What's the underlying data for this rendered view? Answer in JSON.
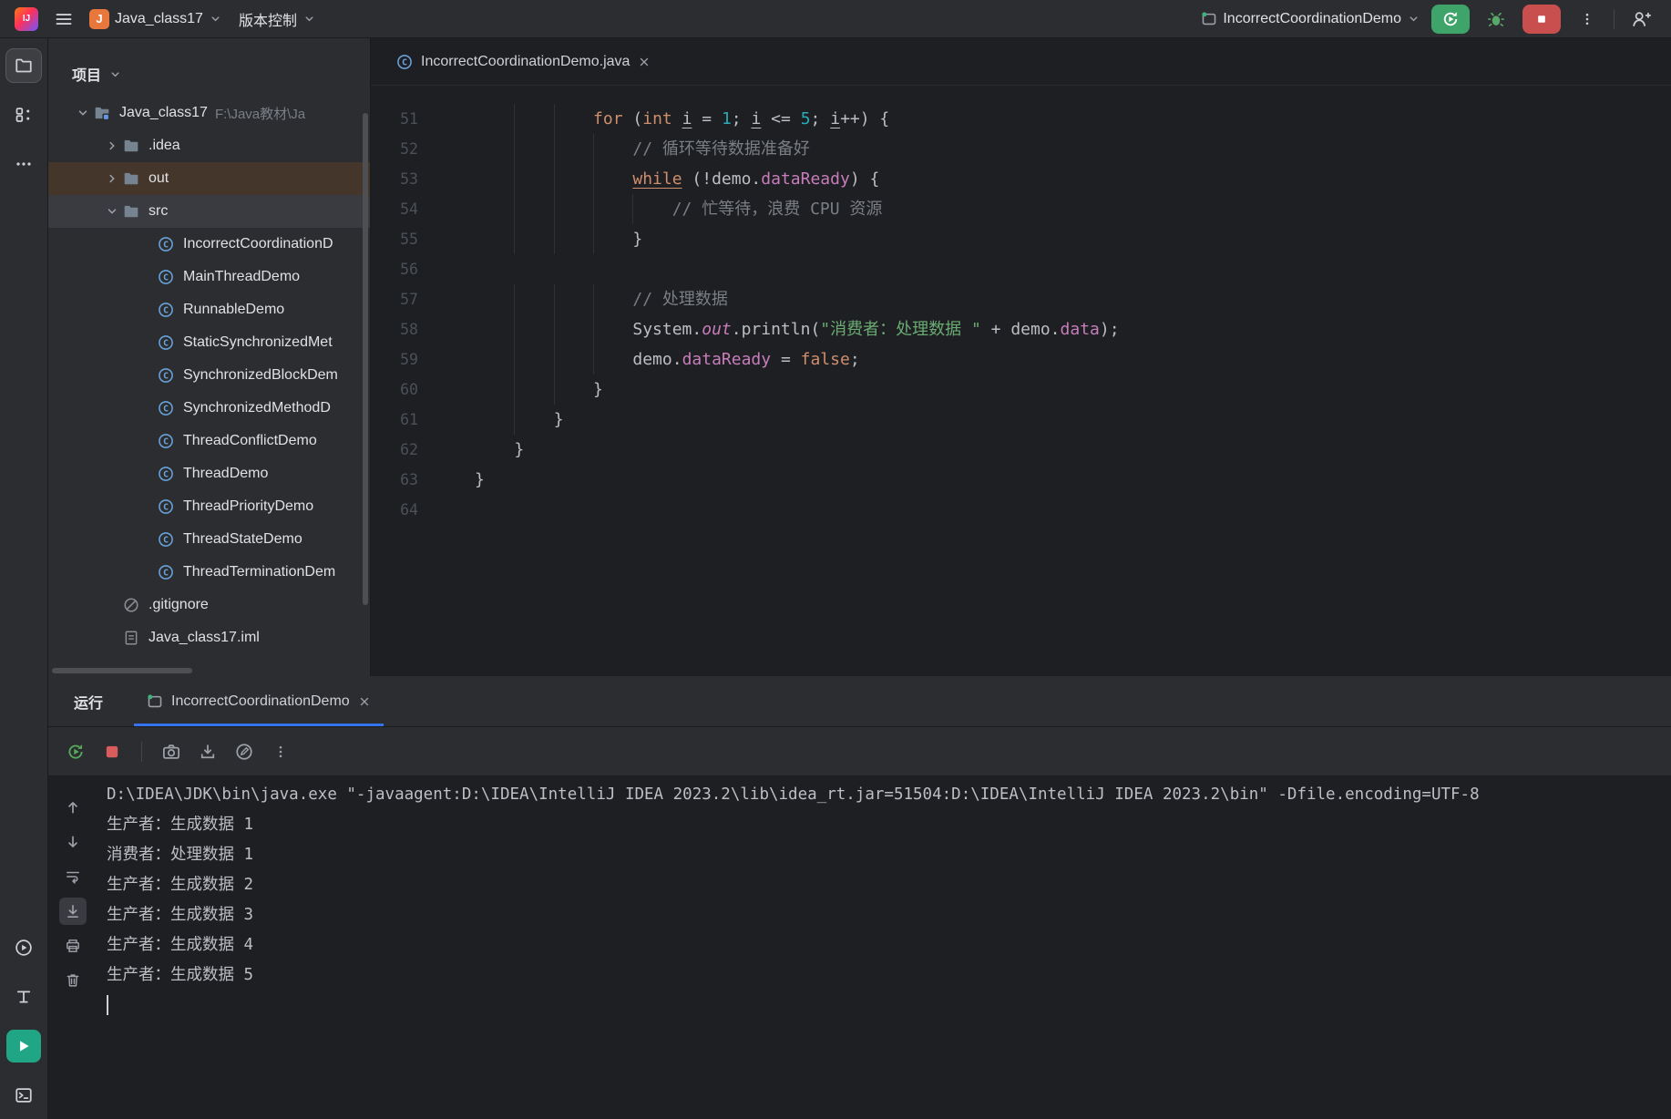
{
  "colors": {
    "accent": "#3574f0",
    "run_green": "#3fa469",
    "stop_red": "#c94f4f",
    "tool_teal": "#21a685",
    "tab_underline": "#3574f0"
  },
  "titlebar": {
    "logo_text": "IJ",
    "project_badge_letter": "J",
    "project_name": "Java_class17",
    "vcs_label": "版本控制",
    "run_config_name": "IncorrectCoordinationDemo",
    "icons": [
      "menu-icon",
      "chevron-down-icon",
      "run-config-window-icon",
      "rerun-icon",
      "debug-icon",
      "stop-icon",
      "more-vertical-icon",
      "add-user-icon"
    ]
  },
  "toolstrip": {
    "top": [
      {
        "icon": "project-folder",
        "selected": true
      },
      {
        "icon": "structure",
        "selected": false
      },
      {
        "icon": "more",
        "selected": false
      }
    ],
    "bottom": [
      {
        "icon": "services",
        "selected": false
      },
      {
        "icon": "hierarchy",
        "selected": false
      },
      {
        "icon": "run-tool",
        "selected": true,
        "accent": true
      },
      {
        "icon": "terminal",
        "selected": false
      }
    ]
  },
  "project_panel": {
    "title": "项目",
    "items": [
      {
        "level": 0,
        "chevron": "down",
        "icon": "folder-root",
        "name": "Java_class17",
        "path": "F:\\Java教材\\Ja"
      },
      {
        "level": 1,
        "chevron": "right",
        "icon": "folder",
        "name": ".idea"
      },
      {
        "level": 1,
        "chevron": "right",
        "icon": "folder",
        "name": "out",
        "state": "highlighted"
      },
      {
        "level": 1,
        "chevron": "down",
        "icon": "folder",
        "name": "src",
        "state": "selected"
      },
      {
        "level": 2,
        "icon": "class",
        "name": "IncorrectCoordinationD"
      },
      {
        "level": 2,
        "icon": "class",
        "name": "MainThreadDemo"
      },
      {
        "level": 2,
        "icon": "class",
        "name": "RunnableDemo"
      },
      {
        "level": 2,
        "icon": "class",
        "name": "StaticSynchronizedMet"
      },
      {
        "level": 2,
        "icon": "class",
        "name": "SynchronizedBlockDem"
      },
      {
        "level": 2,
        "icon": "class",
        "name": "SynchronizedMethodD"
      },
      {
        "level": 2,
        "icon": "class",
        "name": "ThreadConflictDemo"
      },
      {
        "level": 2,
        "icon": "class",
        "name": "ThreadDemo"
      },
      {
        "level": 2,
        "icon": "class",
        "name": "ThreadPriorityDemo"
      },
      {
        "level": 2,
        "icon": "class",
        "name": "ThreadStateDemo"
      },
      {
        "level": 2,
        "icon": "class",
        "name": "ThreadTerminationDem"
      },
      {
        "level": 1,
        "icon": "ignore",
        "name": ".gitignore"
      },
      {
        "level": 1,
        "icon": "iml",
        "name": "Java_class17.iml"
      }
    ]
  },
  "editor": {
    "tab_label": "IncorrectCoordinationDemo.java",
    "lines": [
      {
        "n": 51,
        "ind": 12,
        "tok": [
          [
            "kw",
            "for"
          ],
          [
            "pln",
            " ("
          ],
          [
            "kw",
            "int"
          ],
          [
            "pln",
            " "
          ],
          [
            "var",
            "i"
          ],
          [
            "pln",
            " = "
          ],
          [
            "num",
            "1"
          ],
          [
            "pln",
            "; "
          ],
          [
            "var",
            "i"
          ],
          [
            "pln",
            " <= "
          ],
          [
            "num",
            "5"
          ],
          [
            "pln",
            "; "
          ],
          [
            "var",
            "i"
          ],
          [
            "pln",
            "++) {"
          ]
        ]
      },
      {
        "n": 52,
        "ind": 16,
        "tok": [
          [
            "cmt",
            "// 循环等待数据准备好"
          ]
        ]
      },
      {
        "n": 53,
        "ind": 16,
        "tok": [
          [
            "kwund",
            "while"
          ],
          [
            "pln",
            " (!demo."
          ],
          [
            "fld",
            "dataReady"
          ],
          [
            "pln",
            ") {"
          ]
        ]
      },
      {
        "n": 54,
        "ind": 20,
        "tok": [
          [
            "cmt",
            "// 忙等待，浪费 CPU 资源"
          ]
        ]
      },
      {
        "n": 55,
        "ind": 16,
        "tok": [
          [
            "pln",
            "}"
          ]
        ]
      },
      {
        "n": 56,
        "ind": 0,
        "tok": []
      },
      {
        "n": 57,
        "ind": 16,
        "tok": [
          [
            "cmt",
            "// 处理数据"
          ]
        ]
      },
      {
        "n": 58,
        "ind": 16,
        "tok": [
          [
            "pln",
            "System."
          ],
          [
            "fldit",
            "out"
          ],
          [
            "pln",
            ".println("
          ],
          [
            "str",
            "\"消费者：处理数据 \""
          ],
          [
            "pln",
            " + demo."
          ],
          [
            "fld",
            "data"
          ],
          [
            "pln",
            ");"
          ]
        ]
      },
      {
        "n": 59,
        "ind": 16,
        "tok": [
          [
            "pln",
            "demo."
          ],
          [
            "fld",
            "dataReady"
          ],
          [
            "pln",
            " = "
          ],
          [
            "kw",
            "false"
          ],
          [
            "pln",
            ";"
          ]
        ]
      },
      {
        "n": 60,
        "ind": 12,
        "tok": [
          [
            "pln",
            "}"
          ]
        ]
      },
      {
        "n": 61,
        "ind": 8,
        "tok": [
          [
            "pln",
            "}"
          ]
        ]
      },
      {
        "n": 62,
        "ind": 4,
        "tok": [
          [
            "pln",
            "}"
          ]
        ]
      },
      {
        "n": 63,
        "ind": 0,
        "tok": [
          [
            "pln",
            "}"
          ]
        ]
      },
      {
        "n": 64,
        "ind": 0,
        "tok": []
      }
    ]
  },
  "run_panel": {
    "title": "运行",
    "tab_label": "IncorrectCoordinationDemo",
    "toolbar": [
      "rerun",
      "stop",
      "separator",
      "camera",
      "export",
      "edit",
      "more-v"
    ],
    "console": {
      "gutter": [
        {
          "icon": "up"
        },
        {
          "icon": "down"
        },
        {
          "icon": "softwrap"
        },
        {
          "icon": "scrollend",
          "selected": true
        },
        {
          "icon": "print"
        },
        {
          "icon": "clear"
        }
      ],
      "lines": [
        "D:\\IDEA\\JDK\\bin\\java.exe \"-javaagent:D:\\IDEA\\IntelliJ IDEA 2023.2\\lib\\idea_rt.jar=51504:D:\\IDEA\\IntelliJ IDEA 2023.2\\bin\" -Dfile.encoding=UTF-8",
        "生产者：生成数据 1",
        "消费者：处理数据 1",
        "生产者：生成数据 2",
        "生产者：生成数据 3",
        "生产者：生成数据 4",
        "生产者：生成数据 5"
      ]
    }
  }
}
